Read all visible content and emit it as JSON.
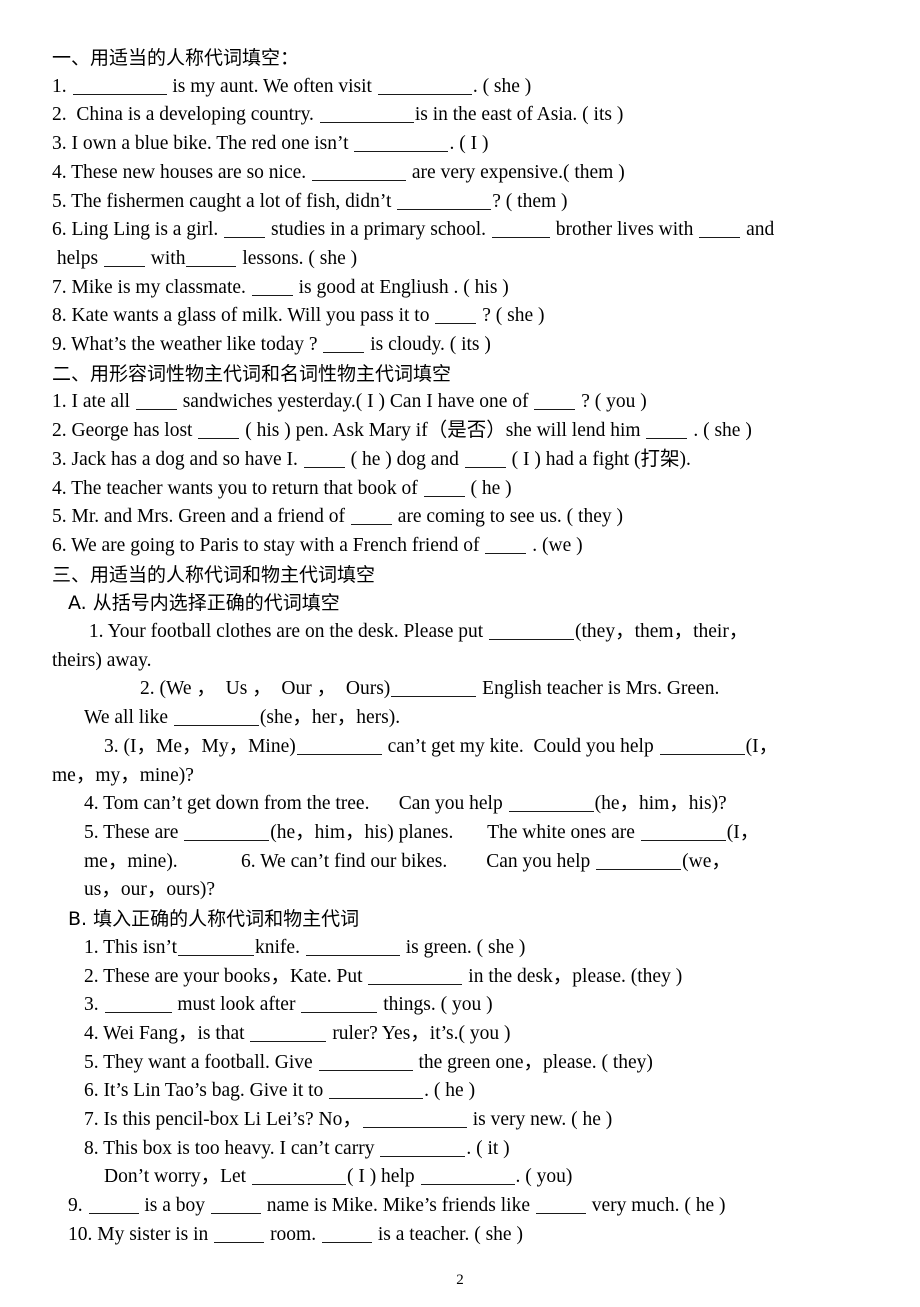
{
  "document": {
    "page_number": "2",
    "sections": [
      {
        "id": "section-1",
        "heading": "一、用适当的人称代词填空：",
        "items": [
          {
            "id": "s1-q1",
            "parts": [
              {
                "t": "text",
                "v": "1. "
              },
              {
                "t": "blank",
                "w": 10
              },
              {
                "t": "text",
                "v": " is my aunt. We often visit "
              },
              {
                "t": "blank",
                "w": 10
              },
              {
                "t": "text",
                "v": ". ( she )"
              }
            ]
          },
          {
            "id": "s1-q2",
            "parts": [
              {
                "t": "text",
                "v": "2.  China is a developing country. "
              },
              {
                "t": "blank",
                "w": 10
              },
              {
                "t": "text",
                "v": "is in the east of Asia. ( its )"
              }
            ]
          },
          {
            "id": "s1-q3",
            "parts": [
              {
                "t": "text",
                "v": "3. I own a blue bike. The red one isn’t "
              },
              {
                "t": "blank",
                "w": 10
              },
              {
                "t": "text",
                "v": ". ( I )"
              }
            ]
          },
          {
            "id": "s1-q4",
            "parts": [
              {
                "t": "text",
                "v": "4. These new houses are so nice. "
              },
              {
                "t": "blank",
                "w": 10
              },
              {
                "t": "text",
                "v": " are very expensive.( them )"
              }
            ]
          },
          {
            "id": "s1-q5",
            "parts": [
              {
                "t": "text",
                "v": "5. The fishermen caught a lot of fish, didn’t "
              },
              {
                "t": "blank",
                "w": 10
              },
              {
                "t": "text",
                "v": "? ( them )"
              }
            ]
          },
          {
            "id": "s1-q6",
            "parts": [
              {
                "t": "text",
                "v": "6. Ling Ling is a girl. "
              },
              {
                "t": "blank",
                "w": 4
              },
              {
                "t": "text",
                "v": " studies in a primary school. "
              },
              {
                "t": "blank",
                "w": 6
              },
              {
                "t": "text",
                "v": " brother lives with "
              },
              {
                "t": "blank",
                "w": 4
              },
              {
                "t": "text",
                "v": " and"
              }
            ]
          },
          {
            "id": "s1-q6b",
            "parts": [
              {
                "t": "text",
                "v": " helps "
              },
              {
                "t": "blank",
                "w": 4
              },
              {
                "t": "text",
                "v": " with"
              },
              {
                "t": "blank",
                "w": 5
              },
              {
                "t": "text",
                "v": " lessons. ( she )"
              }
            ]
          },
          {
            "id": "s1-q7",
            "parts": [
              {
                "t": "text",
                "v": "7. Mike is my classmate. "
              },
              {
                "t": "blank",
                "w": 4
              },
              {
                "t": "text",
                "v": " is good at Engliush . ( his )"
              }
            ]
          },
          {
            "id": "s1-q8",
            "parts": [
              {
                "t": "text",
                "v": "8. Kate wants a glass of milk. Will you pass it to "
              },
              {
                "t": "blank",
                "w": 4
              },
              {
                "t": "text",
                "v": " ? ( she )"
              }
            ]
          },
          {
            "id": "s1-q9",
            "parts": [
              {
                "t": "text",
                "v": "9. What’s the weather like today ? "
              },
              {
                "t": "blank",
                "w": 4
              },
              {
                "t": "text",
                "v": " is cloudy. ( its )"
              }
            ]
          }
        ]
      },
      {
        "id": "section-2",
        "heading": "二、用形容词性物主代词和名词性物主代词填空",
        "items": [
          {
            "id": "s2-q1",
            "parts": [
              {
                "t": "text",
                "v": "1. I ate all "
              },
              {
                "t": "blank",
                "w": 4
              },
              {
                "t": "text",
                "v": " sandwiches yesterday.( I ) Can I have one of "
              },
              {
                "t": "blank",
                "w": 4
              },
              {
                "t": "text",
                "v": " ? ( you )"
              }
            ]
          },
          {
            "id": "s2-q2",
            "parts": [
              {
                "t": "text",
                "v": "2. George has lost "
              },
              {
                "t": "blank",
                "w": 4
              },
              {
                "t": "text",
                "v": " ( his ) pen. Ask Mary if（是否）she will lend him "
              },
              {
                "t": "blank",
                "w": 4
              },
              {
                "t": "text",
                "v": " . ( she )"
              }
            ]
          },
          {
            "id": "s2-q3",
            "parts": [
              {
                "t": "text",
                "v": "3. Jack has a dog and so have I. "
              },
              {
                "t": "blank",
                "w": 4
              },
              {
                "t": "text",
                "v": " ( he ) dog and "
              },
              {
                "t": "blank",
                "w": 4
              },
              {
                "t": "text",
                "v": " ( I ) had a fight (打架)."
              }
            ]
          },
          {
            "id": "s2-q4",
            "parts": [
              {
                "t": "text",
                "v": "4. The teacher wants you to return that book of "
              },
              {
                "t": "blank",
                "w": 4
              },
              {
                "t": "text",
                "v": " ( he )"
              }
            ]
          },
          {
            "id": "s2-q5",
            "parts": [
              {
                "t": "text",
                "v": "5. Mr. and Mrs. Green and a friend of "
              },
              {
                "t": "blank",
                "w": 4
              },
              {
                "t": "text",
                "v": " are coming to see us. ( they )"
              }
            ]
          },
          {
            "id": "s2-q6",
            "parts": [
              {
                "t": "text",
                "v": "6. We are going to Paris to stay with a French friend of "
              },
              {
                "t": "blank",
                "w": 4
              },
              {
                "t": "text",
                "v": " . (we )"
              }
            ]
          }
        ]
      },
      {
        "id": "section-3",
        "heading": "三、用适当的人称代词和物主代词填空",
        "subsections": [
          {
            "id": "section-3-A",
            "heading": "A. 从括号内选择正确的代词填空",
            "indent": "ind1",
            "items": [
              {
                "id": "s3a-q1",
                "indent": "ind2",
                "parts": [
                  {
                    "t": "text",
                    "v": " 1. Your football clothes are on the desk. Please put "
                  },
                  {
                    "t": "blank",
                    "w": 9
                  },
                  {
                    "t": "text",
                    "v": "(they，them，their，"
                  }
                ]
              },
              {
                "id": "s3a-q1b",
                "indent": "ind-hang",
                "parts": [
                  {
                    "t": "text",
                    "v": "theirs) away."
                  }
                ]
              },
              {
                "id": "s3a-q2",
                "indent": "ind4",
                "parts": [
                  {
                    "t": "text",
                    "v": "2. (We ，  Us ，  Our ，  Ours)"
                  },
                  {
                    "t": "blank",
                    "w": 9
                  },
                  {
                    "t": "text",
                    "v": " English teacher is Mrs. Green."
                  }
                ]
              },
              {
                "id": "s3a-q2b",
                "indent": "ind2",
                "parts": [
                  {
                    "t": "text",
                    "v": "We all like "
                  },
                  {
                    "t": "blank",
                    "w": 9
                  },
                  {
                    "t": "text",
                    "v": "(she，her，hers)."
                  }
                ]
              },
              {
                "id": "s3a-q3",
                "indent": "ind3",
                "parts": [
                  {
                    "t": "text",
                    "v": "3. (I，Me，My，Mine)"
                  },
                  {
                    "t": "blank",
                    "w": 9
                  },
                  {
                    "t": "text",
                    "v": " can’t get my kite.  Could you help "
                  },
                  {
                    "t": "blank",
                    "w": 9
                  },
                  {
                    "t": "text",
                    "v": "(I，"
                  }
                ]
              },
              {
                "id": "s3a-q3b",
                "indent": "ind-hang",
                "parts": [
                  {
                    "t": "text",
                    "v": "me，my，mine)?"
                  }
                ]
              },
              {
                "id": "s3a-q4",
                "indent": "ind2",
                "parts": [
                  {
                    "t": "text",
                    "v": "4. Tom can’t get down from the tree.      Can you help "
                  },
                  {
                    "t": "blank",
                    "w": 9
                  },
                  {
                    "t": "text",
                    "v": "(he，him，his)?"
                  }
                ]
              },
              {
                "id": "s3a-q5",
                "indent": "ind2",
                "parts": [
                  {
                    "t": "text",
                    "v": "5. These are "
                  },
                  {
                    "t": "blank",
                    "w": 9
                  },
                  {
                    "t": "text",
                    "v": "(he，him，his) planes.       The white ones are "
                  },
                  {
                    "t": "blank",
                    "w": 9
                  },
                  {
                    "t": "text",
                    "v": "(I，"
                  }
                ]
              },
              {
                "id": "s3a-q5b",
                "indent": "ind2",
                "parts": [
                  {
                    "t": "text",
                    "v": "me，mine).             6. We can’t find our bikes.        Can you help "
                  },
                  {
                    "t": "blank",
                    "w": 9
                  },
                  {
                    "t": "text",
                    "v": "(we，"
                  }
                ]
              },
              {
                "id": "s3a-q6b",
                "indent": "ind2",
                "parts": [
                  {
                    "t": "text",
                    "v": "us，our，ours)?"
                  }
                ]
              }
            ]
          },
          {
            "id": "section-3-B",
            "heading": "B. 填入正确的人称代词和物主代词",
            "indent": "ind1",
            "items": [
              {
                "id": "s3b-q1",
                "indent": "ind2",
                "parts": [
                  {
                    "t": "text",
                    "v": "1. This isn’t"
                  },
                  {
                    "t": "blank",
                    "w": 8
                  },
                  {
                    "t": "text",
                    "v": "knife. "
                  },
                  {
                    "t": "blank",
                    "w": 10
                  },
                  {
                    "t": "text",
                    "v": " is green. ( she )"
                  }
                ]
              },
              {
                "id": "s3b-q2",
                "indent": "ind2",
                "parts": [
                  {
                    "t": "text",
                    "v": "2. These are your books，Kate. Put "
                  },
                  {
                    "t": "blank",
                    "w": 10
                  },
                  {
                    "t": "text",
                    "v": " in the desk，please. (they )"
                  }
                ]
              },
              {
                "id": "s3b-q3",
                "indent": "ind2",
                "parts": [
                  {
                    "t": "text",
                    "v": "3. "
                  },
                  {
                    "t": "blank",
                    "w": 7
                  },
                  {
                    "t": "text",
                    "v": " must look after "
                  },
                  {
                    "t": "blank",
                    "w": 8
                  },
                  {
                    "t": "text",
                    "v": " things. ( you )"
                  }
                ]
              },
              {
                "id": "s3b-q4",
                "indent": "ind2",
                "parts": [
                  {
                    "t": "text",
                    "v": "4. Wei Fang，is that "
                  },
                  {
                    "t": "blank",
                    "w": 8
                  },
                  {
                    "t": "text",
                    "v": " ruler? Yes，it’s.( you )"
                  }
                ]
              },
              {
                "id": "s3b-q5",
                "indent": "ind2",
                "parts": [
                  {
                    "t": "text",
                    "v": "5. They want a football. Give "
                  },
                  {
                    "t": "blank",
                    "w": 10
                  },
                  {
                    "t": "text",
                    "v": " the green one，please. ( they)"
                  }
                ]
              },
              {
                "id": "s3b-q6",
                "indent": "ind2",
                "parts": [
                  {
                    "t": "text",
                    "v": "6. It’s Lin Tao’s bag. Give it to "
                  },
                  {
                    "t": "blank",
                    "w": 10
                  },
                  {
                    "t": "text",
                    "v": ". ( he )"
                  }
                ]
              },
              {
                "id": "s3b-q7",
                "indent": "ind2",
                "parts": [
                  {
                    "t": "text",
                    "v": "7. Is this pencil-box Li Lei’s? No，"
                  },
                  {
                    "t": "blank",
                    "w": 11
                  },
                  {
                    "t": "text",
                    "v": " is very new. ( he )"
                  }
                ]
              },
              {
                "id": "s3b-q8",
                "indent": "ind2",
                "parts": [
                  {
                    "t": "text",
                    "v": "8. This box is too heavy. I can’t carry "
                  },
                  {
                    "t": "blank",
                    "w": 9
                  },
                  {
                    "t": "text",
                    "v": ". ( it )"
                  }
                ]
              },
              {
                "id": "s3b-q8b",
                "indent": "ind3",
                "parts": [
                  {
                    "t": "text",
                    "v": "Don’t worry，Let "
                  },
                  {
                    "t": "blank",
                    "w": 10
                  },
                  {
                    "t": "text",
                    "v": "( I ) help "
                  },
                  {
                    "t": "blank",
                    "w": 10
                  },
                  {
                    "t": "text",
                    "v": ". ( you)"
                  }
                ]
              },
              {
                "id": "s3b-q9",
                "indent": "ind1",
                "parts": [
                  {
                    "t": "text",
                    "v": "9. "
                  },
                  {
                    "t": "blank",
                    "w": 5
                  },
                  {
                    "t": "text",
                    "v": " is a boy "
                  },
                  {
                    "t": "blank",
                    "w": 5
                  },
                  {
                    "t": "text",
                    "v": " name is Mike. Mike’s friends like "
                  },
                  {
                    "t": "blank",
                    "w": 5
                  },
                  {
                    "t": "text",
                    "v": " very much. ( he )"
                  }
                ]
              },
              {
                "id": "s3b-q10",
                "indent": "ind1",
                "parts": [
                  {
                    "t": "text",
                    "v": "10. My sister is in "
                  },
                  {
                    "t": "blank",
                    "w": 5
                  },
                  {
                    "t": "text",
                    "v": " room. "
                  },
                  {
                    "t": "blank",
                    "w": 5
                  },
                  {
                    "t": "text",
                    "v": " is a teacher. ( she )"
                  }
                ]
              }
            ]
          }
        ]
      }
    ]
  }
}
